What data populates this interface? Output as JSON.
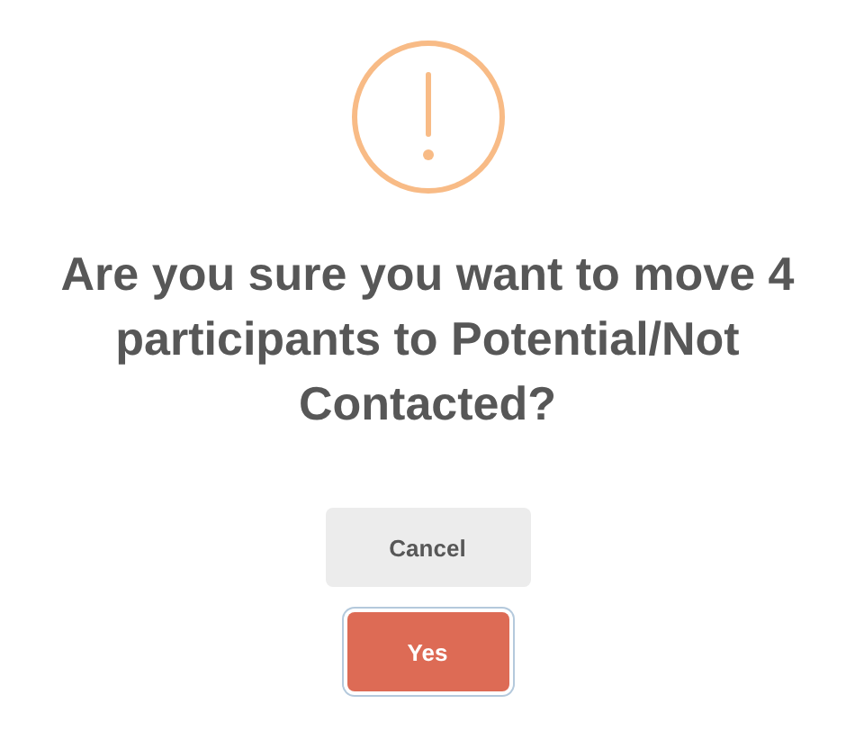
{
  "dialog": {
    "title": "Are you sure you want to move 4 participants to Potential/Not Contacted?",
    "buttons": [
      {
        "label": "Cancel",
        "kind": "cancel",
        "focused": false
      },
      {
        "label": "Yes",
        "kind": "confirm",
        "focused": true
      }
    ]
  }
}
